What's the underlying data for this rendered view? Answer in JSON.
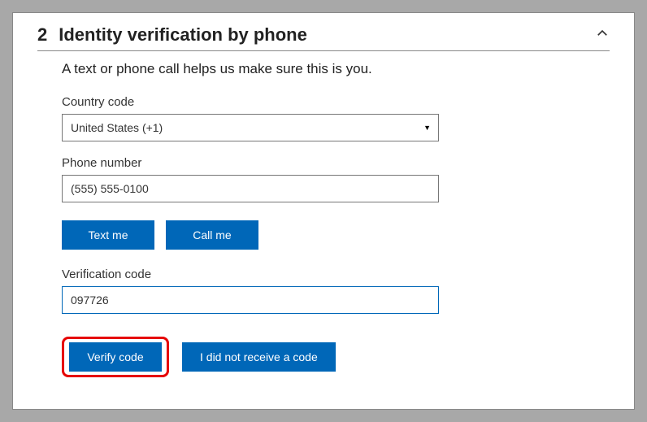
{
  "step": {
    "number": "2",
    "title": "Identity verification by phone"
  },
  "subtitle": "A text or phone call helps us make sure this is you.",
  "fields": {
    "country_code": {
      "label": "Country code",
      "value": "United States (+1)"
    },
    "phone_number": {
      "label": "Phone number",
      "value": "(555) 555-0100"
    },
    "verification_code": {
      "label": "Verification code",
      "value": "097726"
    }
  },
  "buttons": {
    "text_me": "Text me",
    "call_me": "Call me",
    "verify_code": "Verify code",
    "no_code": "I did not receive a code"
  },
  "colors": {
    "primary": "#0067b8",
    "highlight": "#e60000"
  }
}
